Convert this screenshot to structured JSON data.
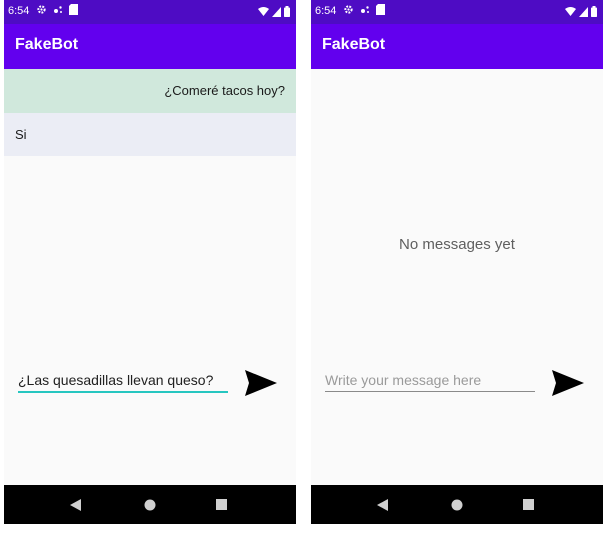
{
  "phones": [
    {
      "status": {
        "time": "6:54"
      },
      "app": {
        "title": "FakeBot"
      },
      "messages": {
        "user": "¿Comeré tacos hoy?",
        "bot": "Si"
      },
      "input": {
        "value": "¿Las quesadillas llevan queso?"
      }
    },
    {
      "status": {
        "time": "6:54"
      },
      "app": {
        "title": "FakeBot"
      },
      "empty_state": "No messages yet",
      "input": {
        "value": "",
        "placeholder": "Write your message here"
      }
    }
  ],
  "colors": {
    "status_bar": "#4e0cc4",
    "app_bar": "#6200ee",
    "user_message_bg": "#d0e8dc",
    "bot_message_bg": "#ebedf5",
    "input_focus_underline": "#26c6c0"
  },
  "icons": [
    "gear-icon",
    "sim-icon",
    "wifi-icon",
    "signal-icon",
    "battery-icon",
    "send-icon",
    "nav-back-icon",
    "nav-home-icon",
    "nav-recents-icon"
  ]
}
